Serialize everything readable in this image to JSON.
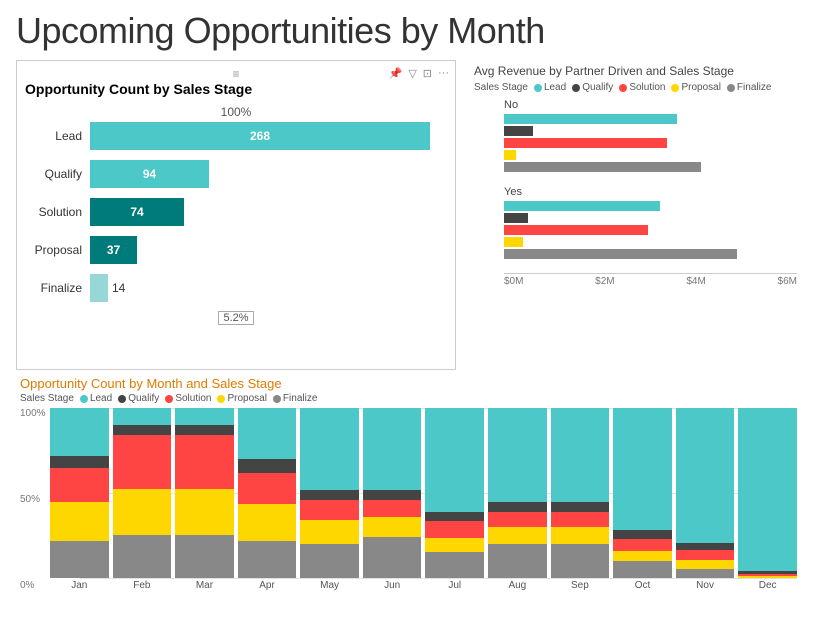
{
  "page": {
    "title": "Upcoming Opportunities by Month"
  },
  "left_chart": {
    "title": "Opportunity Count by Sales Stage",
    "top_label": "100%",
    "bottom_label": "5.2%",
    "bars": [
      {
        "label": "Lead",
        "value": 268,
        "pct": 1.0,
        "color": "#4DC8C8",
        "value_inside": true
      },
      {
        "label": "Qualify",
        "value": 94,
        "pct": 0.351,
        "color": "#4DC8C8",
        "value_inside": true
      },
      {
        "label": "Solution",
        "value": 74,
        "pct": 0.276,
        "color": "#007B7B",
        "value_inside": true
      },
      {
        "label": "Proposal",
        "value": 37,
        "pct": 0.138,
        "color": "#007B7B",
        "value_inside": true
      },
      {
        "label": "Finalize",
        "value": 14,
        "pct": 0.052,
        "color": "#96D8D8",
        "value_inside": false
      }
    ]
  },
  "right_chart": {
    "title": "Avg Revenue by Partner Driven and Sales Stage",
    "legend_label": "Sales Stage",
    "legend_items": [
      {
        "label": "Lead",
        "color": "#4DC8C8"
      },
      {
        "label": "Qualify",
        "color": "#444"
      },
      {
        "label": "Solution",
        "color": "#FF4444"
      },
      {
        "label": "Proposal",
        "color": "#FFD700"
      },
      {
        "label": "Finalize",
        "color": "#888"
      }
    ],
    "groups": [
      {
        "label": "No",
        "bars": [
          {
            "stage": "Lead",
            "color": "#4DC8C8",
            "pct": 0.72
          },
          {
            "stage": "Qualify",
            "color": "#444",
            "pct": 0.12
          },
          {
            "stage": "Solution",
            "color": "#FF4444",
            "pct": 0.68
          },
          {
            "stage": "Proposal",
            "color": "#FFD700",
            "pct": 0.05
          },
          {
            "stage": "Finalize",
            "color": "#888",
            "pct": 0.82
          }
        ]
      },
      {
        "label": "Yes",
        "bars": [
          {
            "stage": "Lead",
            "color": "#4DC8C8",
            "pct": 0.65
          },
          {
            "stage": "Qualify",
            "color": "#444",
            "pct": 0.1
          },
          {
            "stage": "Solution",
            "color": "#FF4444",
            "pct": 0.6
          },
          {
            "stage": "Proposal",
            "color": "#FFD700",
            "pct": 0.08
          },
          {
            "stage": "Finalize",
            "color": "#888",
            "pct": 0.97
          }
        ]
      }
    ],
    "axis_labels": [
      "$0M",
      "$2M",
      "$4M",
      "$6M"
    ]
  },
  "bottom_chart": {
    "title": "Opportunity Count by Month and Sales Stage",
    "legend_label": "Sales Stage",
    "legend_items": [
      {
        "label": "Lead",
        "color": "#4DC8C8"
      },
      {
        "label": "Qualify",
        "color": "#444"
      },
      {
        "label": "Solution",
        "color": "#FF4444"
      },
      {
        "label": "Proposal",
        "color": "#FFD700"
      },
      {
        "label": "Finalize",
        "color": "#888"
      }
    ],
    "y_labels": [
      "100%",
      "50%",
      "0%"
    ],
    "months": [
      "Jan",
      "Feb",
      "Mar",
      "Apr",
      "May",
      "Jun",
      "Jul",
      "Aug",
      "Sep",
      "Oct",
      "Nov",
      "Dec"
    ],
    "data": [
      {
        "month": "Jan",
        "lead": 0.28,
        "qualify": 0.07,
        "solution": 0.2,
        "proposal": 0.23,
        "finalize": 0.22
      },
      {
        "month": "Feb",
        "lead": 0.1,
        "qualify": 0.06,
        "solution": 0.32,
        "proposal": 0.27,
        "finalize": 0.25
      },
      {
        "month": "Mar",
        "lead": 0.1,
        "qualify": 0.06,
        "solution": 0.32,
        "proposal": 0.27,
        "finalize": 0.25
      },
      {
        "month": "Apr",
        "lead": 0.3,
        "qualify": 0.08,
        "solution": 0.18,
        "proposal": 0.22,
        "finalize": 0.22
      },
      {
        "month": "May",
        "lead": 0.48,
        "qualify": 0.06,
        "solution": 0.12,
        "proposal": 0.14,
        "finalize": 0.2
      },
      {
        "month": "Jun",
        "lead": 0.48,
        "qualify": 0.06,
        "solution": 0.1,
        "proposal": 0.12,
        "finalize": 0.24
      },
      {
        "month": "Jul",
        "lead": 0.62,
        "qualify": 0.05,
        "solution": 0.1,
        "proposal": 0.08,
        "finalize": 0.15
      },
      {
        "month": "Aug",
        "lead": 0.55,
        "qualify": 0.06,
        "solution": 0.09,
        "proposal": 0.1,
        "finalize": 0.2
      },
      {
        "month": "Sep",
        "lead": 0.55,
        "qualify": 0.06,
        "solution": 0.09,
        "proposal": 0.1,
        "finalize": 0.2
      },
      {
        "month": "Oct",
        "lead": 0.72,
        "qualify": 0.05,
        "solution": 0.07,
        "proposal": 0.06,
        "finalize": 0.1
      },
      {
        "month": "Nov",
        "lead": 0.8,
        "qualify": 0.04,
        "solution": 0.06,
        "proposal": 0.05,
        "finalize": 0.05
      },
      {
        "month": "Dec",
        "lead": 0.96,
        "qualify": 0.02,
        "solution": 0.01,
        "proposal": 0.01,
        "finalize": 0.0
      }
    ]
  }
}
